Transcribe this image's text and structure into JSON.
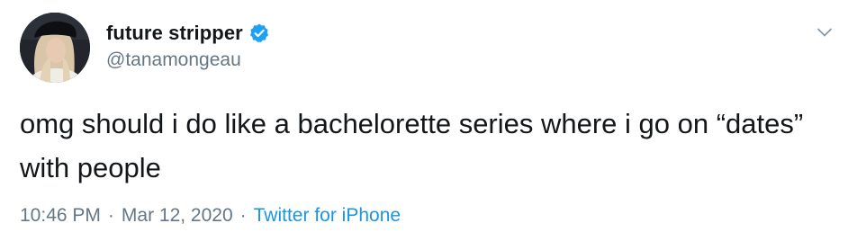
{
  "author": {
    "display_name": "future stripper",
    "handle": "@tanamongeau",
    "verified": true,
    "avatar_icon": "profile-photo",
    "verified_icon": "verified-badge-icon"
  },
  "tweet": {
    "text": "omg should i do like a bachelorette series where i go on “dates” with people",
    "time": "10:46 PM",
    "separator": "·",
    "date": "Mar 12, 2020",
    "source": "Twitter for iPhone"
  },
  "colors": {
    "text": "#14171a",
    "secondary": "#657786",
    "link": "#1b95e0",
    "verified": "#1da1f2"
  },
  "menu_icon": "chevron-down-icon"
}
